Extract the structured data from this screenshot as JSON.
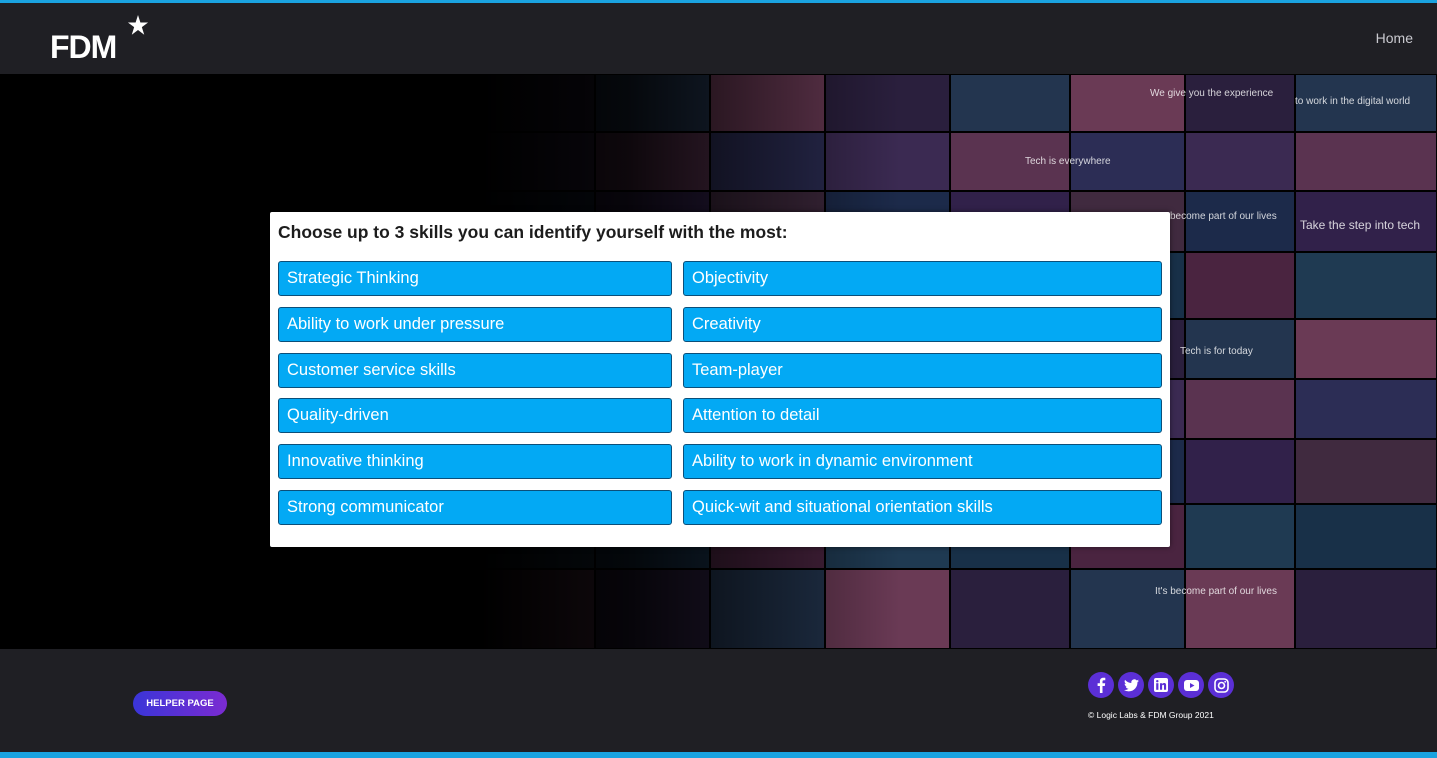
{
  "header": {
    "logo_text": "FDM",
    "nav_home": "Home"
  },
  "skills": {
    "prompt": "Choose up to 3 skills you can identify yourself with the most:",
    "left": [
      "Strategic Thinking",
      "Ability to work under pressure",
      "Customer service skills",
      "Quality-driven",
      "Innovative thinking",
      "Strong communicator"
    ],
    "right": [
      "Objectivity",
      "Creativity",
      "Team-player",
      "Attention to detail",
      "Ability to work in dynamic environment",
      "Quick-wit and situational orientation skills"
    ]
  },
  "hero": {
    "mosaic_captions": [
      "We give you the experience",
      "to work in the digital world",
      "Tech is everywhere",
      "become part of our lives",
      "Take the step into tech",
      "Tech is for today",
      "It's become part of our lives"
    ]
  },
  "footer": {
    "helper_label": "HELPER PAGE",
    "socials": [
      "facebook-icon",
      "twitter-icon",
      "linkedin-icon",
      "youtube-icon",
      "instagram-icon"
    ],
    "copyright": "© Logic Labs & FDM Group 2021"
  },
  "colors": {
    "accent": "#1aa3e0",
    "skill_button": "#03a9f4",
    "social": "#5b2fd6"
  }
}
